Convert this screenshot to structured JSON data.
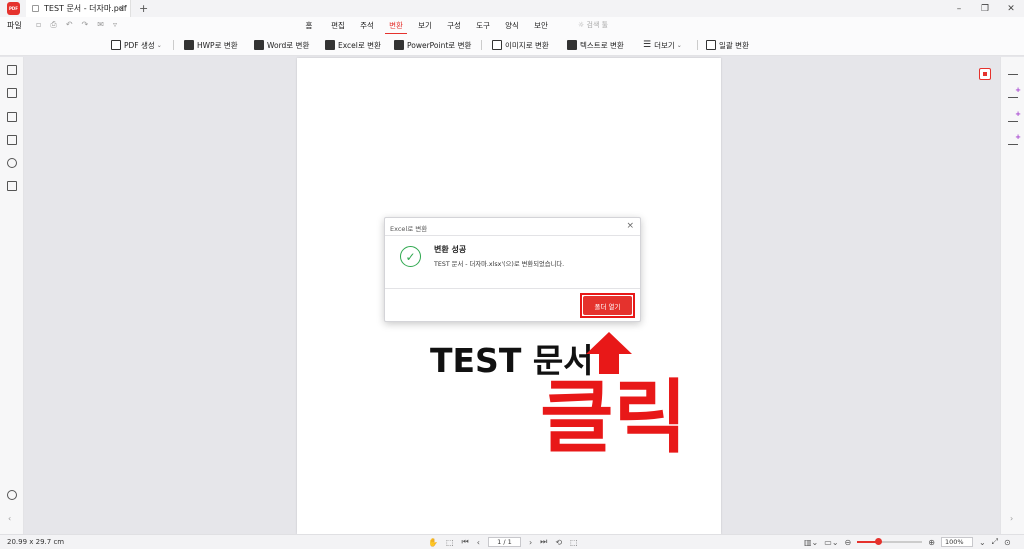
{
  "titlebar": {
    "app_logo": "PDF",
    "tab_title": "TEST 문서 - 더자마.pdf",
    "tab_close": "×",
    "new_tab": "+",
    "minimize": "–",
    "restore": "❐",
    "close": "✕"
  },
  "menubar": {
    "file": "파일",
    "tabs": [
      "홈",
      "편집",
      "주석",
      "변환",
      "보기",
      "구성",
      "도구",
      "양식",
      "보안"
    ],
    "active_tab": "변환",
    "search_placeholder": "검색 툴"
  },
  "ribbon": {
    "create_pdf": "PDF 생성",
    "hwp": "HWP로 변환",
    "word": "Word로 변환",
    "excel": "Excel로 변환",
    "ppt": "PowerPoint로 변환",
    "image": "이미지로 변환",
    "text": "텍스트로 변환",
    "more": "더보기",
    "batch": "일괄 변환"
  },
  "dialog": {
    "title": "Excel로 변환",
    "heading": "변환 성공",
    "message": "TEST 문서 - 더자마.xlsx'(으)로 변환되었습니다.",
    "open_folder": "폴더 열기"
  },
  "annotation": {
    "doc_label": "TEST 문서",
    "click_label": "클릭",
    "arrow_color": "#e81818"
  },
  "statusbar": {
    "page_size": "20.99 x 29.7 cm",
    "page_indicator": "1 / 1",
    "zoom": "100%",
    "zoom_fraction": 0.32
  },
  "colors": {
    "accent": "#e5322d",
    "success": "#2fa84f"
  }
}
